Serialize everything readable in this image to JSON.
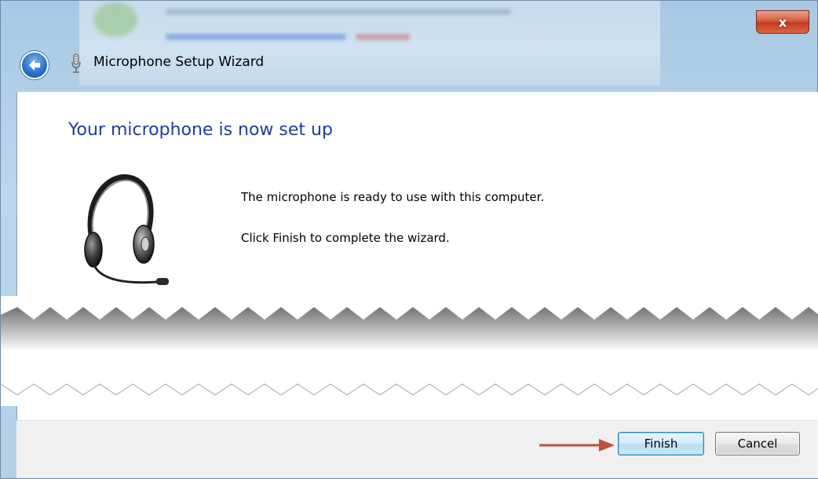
{
  "window": {
    "title": "Microphone Setup Wizard",
    "close_label": "x"
  },
  "content": {
    "heading": "Your microphone is now set up",
    "message_ready": "The microphone is ready to use with this computer.",
    "message_finish": "Click Finish to complete the wizard."
  },
  "footer": {
    "finish_label": "Finish",
    "cancel_label": "Cancel"
  },
  "colors": {
    "heading": "#1e3f9a",
    "arrow": "#c0503a",
    "close": "#c13a22"
  },
  "icons": {
    "back": "back-arrow-icon",
    "title": "microphone-icon",
    "illustration": "headset-icon",
    "annotation": "arrow-pointer-icon"
  }
}
